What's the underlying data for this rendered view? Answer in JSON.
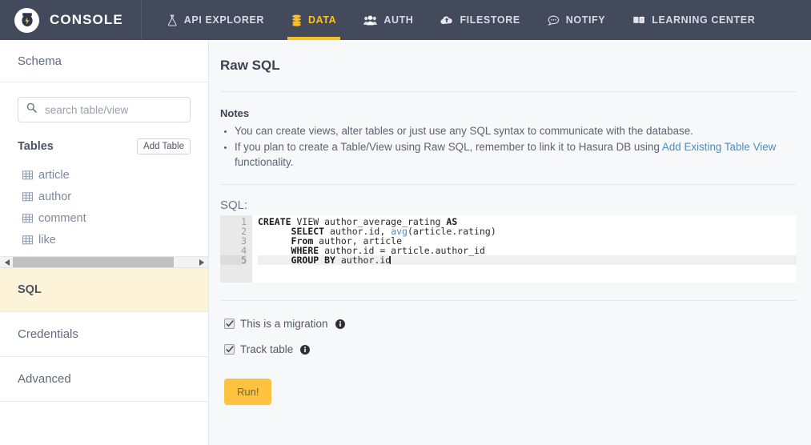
{
  "topnav": {
    "brand": "CONSOLE",
    "logo_icon": "hasura-logo-icon",
    "items": [
      {
        "label": "API EXPLORER",
        "icon": "flask-icon",
        "active": false
      },
      {
        "label": "DATA",
        "icon": "database-icon",
        "active": true
      },
      {
        "label": "AUTH",
        "icon": "users-icon",
        "active": false
      },
      {
        "label": "FILESTORE",
        "icon": "cloud-upload-icon",
        "active": false
      },
      {
        "label": "NOTIFY",
        "icon": "comment-icon",
        "active": false
      },
      {
        "label": "LEARNING CENTER",
        "icon": "book-icon",
        "active": false
      }
    ],
    "active_color": "#fdc023",
    "bar_color": "#434a5c"
  },
  "sidebar": {
    "header": "Schema",
    "search": {
      "placeholder": "search table/view",
      "value": "",
      "icon": "search-icon"
    },
    "tables_label": "Tables",
    "add_table_label": "Add Table",
    "tables": [
      {
        "name": "article",
        "icon": "table-grid-icon"
      },
      {
        "name": "author",
        "icon": "table-grid-icon"
      },
      {
        "name": "comment",
        "icon": "table-grid-icon"
      },
      {
        "name": "like",
        "icon": "table-grid-icon"
      }
    ],
    "links": [
      {
        "label": "SQL",
        "active": true
      },
      {
        "label": "Credentials",
        "active": false
      },
      {
        "label": "Advanced",
        "active": false
      }
    ],
    "active_bg": "#fdf3d8"
  },
  "main": {
    "page_title": "Raw SQL",
    "notes_title": "Notes",
    "note_1": "You can create views, alter tables or just use any SQL syntax to communicate with the database.",
    "note_2_before": "If you plan to create a Table/View using Raw SQL, remember to link it to Hasura DB using ",
    "note_2_link": "Add Existing Table View",
    "note_2_after": " functionality.",
    "link_color": "#4a8ec2",
    "sql_label": "SQL:",
    "editor": {
      "line_numbers": [
        "1",
        "2",
        "3",
        "4",
        "5"
      ],
      "active_line": 5,
      "lines": [
        "CREATE VIEW author_average_rating AS",
        "      SELECT author.id, avg(article.rating)",
        "      From author, article",
        "      WHERE author.id = article.author_id",
        "      GROUP BY author.id"
      ],
      "full_text": "CREATE VIEW author_average_rating AS\n      SELECT author.id, avg(article.rating)\n      From author, article\n      WHERE author.id = article.author_id\n      GROUP BY author.id"
    },
    "checkbox_migration": {
      "label": "This is a migration",
      "checked": true,
      "info_icon": "info-circle-icon"
    },
    "checkbox_track": {
      "label": "Track table",
      "checked": true,
      "info_icon": "info-circle-icon"
    },
    "run_button": "Run!",
    "run_button_color": "#fdc23f"
  }
}
